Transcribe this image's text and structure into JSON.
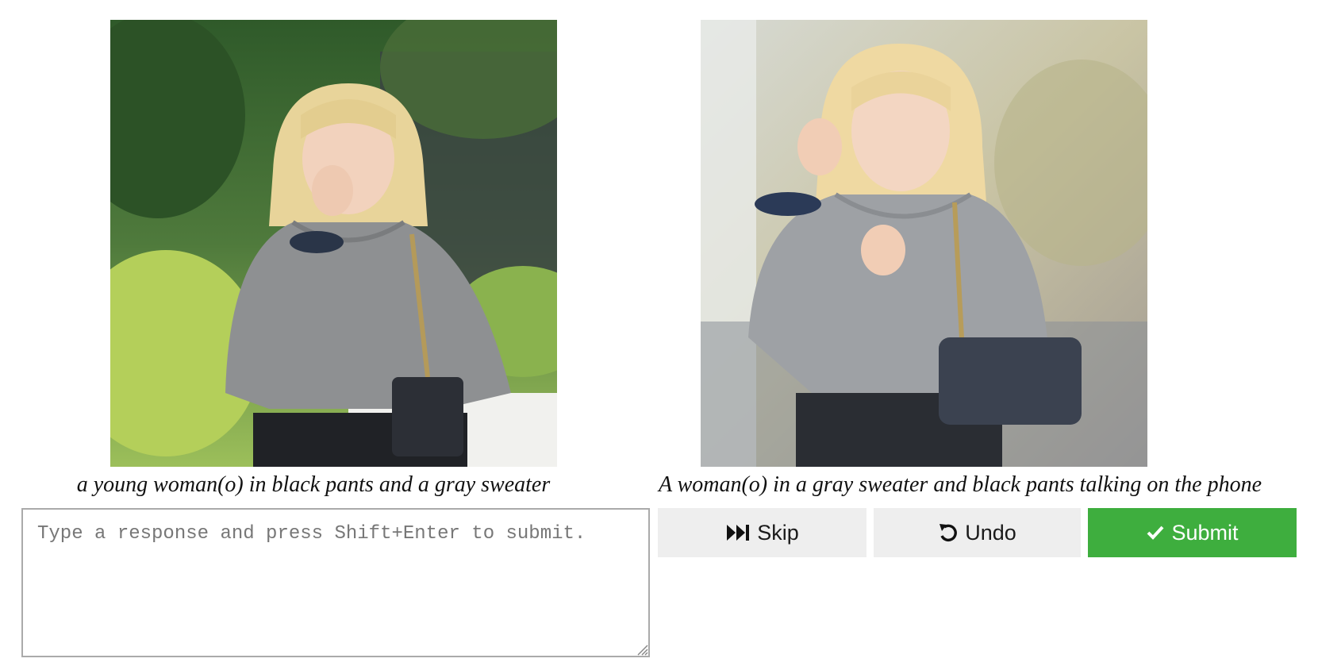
{
  "images": {
    "left": {
      "caption": "a young woman(o) in black pants and a gray sweater"
    },
    "right": {
      "caption": "A woman(o) in a gray sweater and black pants talking on the phone"
    }
  },
  "response": {
    "placeholder": "Type a response and press Shift+Enter to submit.",
    "value": ""
  },
  "buttons": {
    "skip": {
      "label": "Skip",
      "icon": "fast-forward-icon"
    },
    "undo": {
      "label": "Undo",
      "icon": "undo-icon"
    },
    "submit": {
      "label": "Submit",
      "icon": "check-icon"
    }
  },
  "colors": {
    "submit_bg": "#3eae3e",
    "neutral_button_bg": "#eeeeee",
    "border": "#aaaaaa"
  }
}
